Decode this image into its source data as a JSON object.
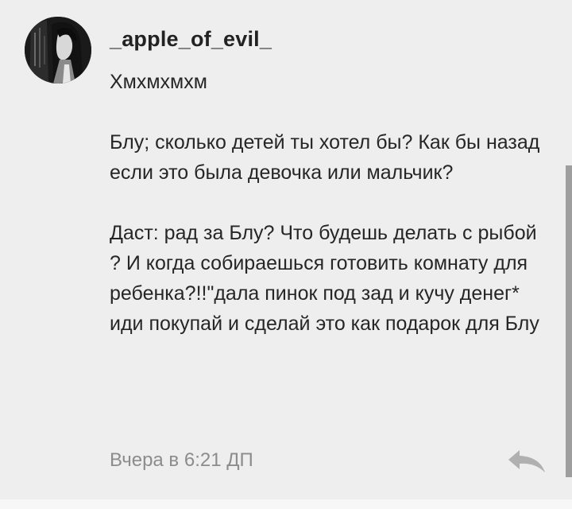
{
  "comment": {
    "username": "_apple_of_evil_",
    "lines": [
      "Хмхмхмхм",
      "Блу; сколько детей ты хотел бы? Как бы назад если это была девочка или мальчик?",
      "Даст: рад за Блу? Что будешь делать с рыбой ? И когда собираешься готовить комнату для ребенка?!!\"дала пинок под зад и кучу денег* иди покупай и сделай это как подарок для Блу"
    ],
    "timestamp": "Вчера в 6:21 ДП",
    "reply_icon": "reply-arrow-icon",
    "avatar_icon": "anime-avatar-icon"
  },
  "colors": {
    "background": "#eeeeee",
    "username": "#222222",
    "text": "#262626",
    "timestamp": "#8c8c8c",
    "reply_icon": "#b0b0b0",
    "scrollbar": "#9e9e9e"
  }
}
